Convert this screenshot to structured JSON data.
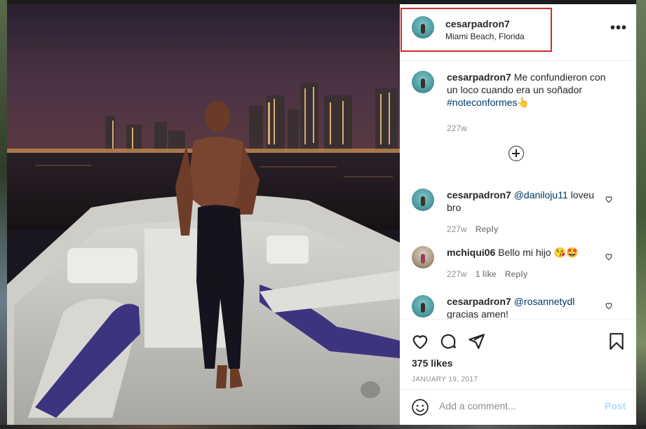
{
  "post": {
    "author": "cesarpadron7",
    "location": "Miami Beach, Florida",
    "more_glyph": "•••"
  },
  "caption": {
    "user": "cesarpadron7",
    "text": "Me confundieron con un loco cuando era un soñador",
    "hashtag": "#noteconformes",
    "emoji": "👆",
    "age": "227w"
  },
  "comments": [
    {
      "user": "cesarpadron7",
      "mention": "@daniloju11",
      "text": "loveu bro",
      "age": "227w",
      "reply": "Reply"
    },
    {
      "user": "mchiqui06",
      "text": "Bello mi hijo",
      "emoji": "😘🤩",
      "age": "227w",
      "likes": "1 like",
      "reply": "Reply"
    },
    {
      "user": "cesarpadron7",
      "mention": "@rosannetydl",
      "text": "gracias amen!"
    }
  ],
  "actions": {
    "likes": "375 likes",
    "date": "JANUARY 19, 2017"
  },
  "add_comment": {
    "placeholder": "Add a comment...",
    "post_label": "Post"
  },
  "icons": [
    "more-options-icon",
    "load-more-icon",
    "heart-icon",
    "comment-icon",
    "share-icon",
    "bookmark-icon",
    "emoji-icon"
  ],
  "colors": {
    "link": "#00376b",
    "highlight_box": "#d62a2a",
    "post_disabled": "#b3dbff"
  }
}
